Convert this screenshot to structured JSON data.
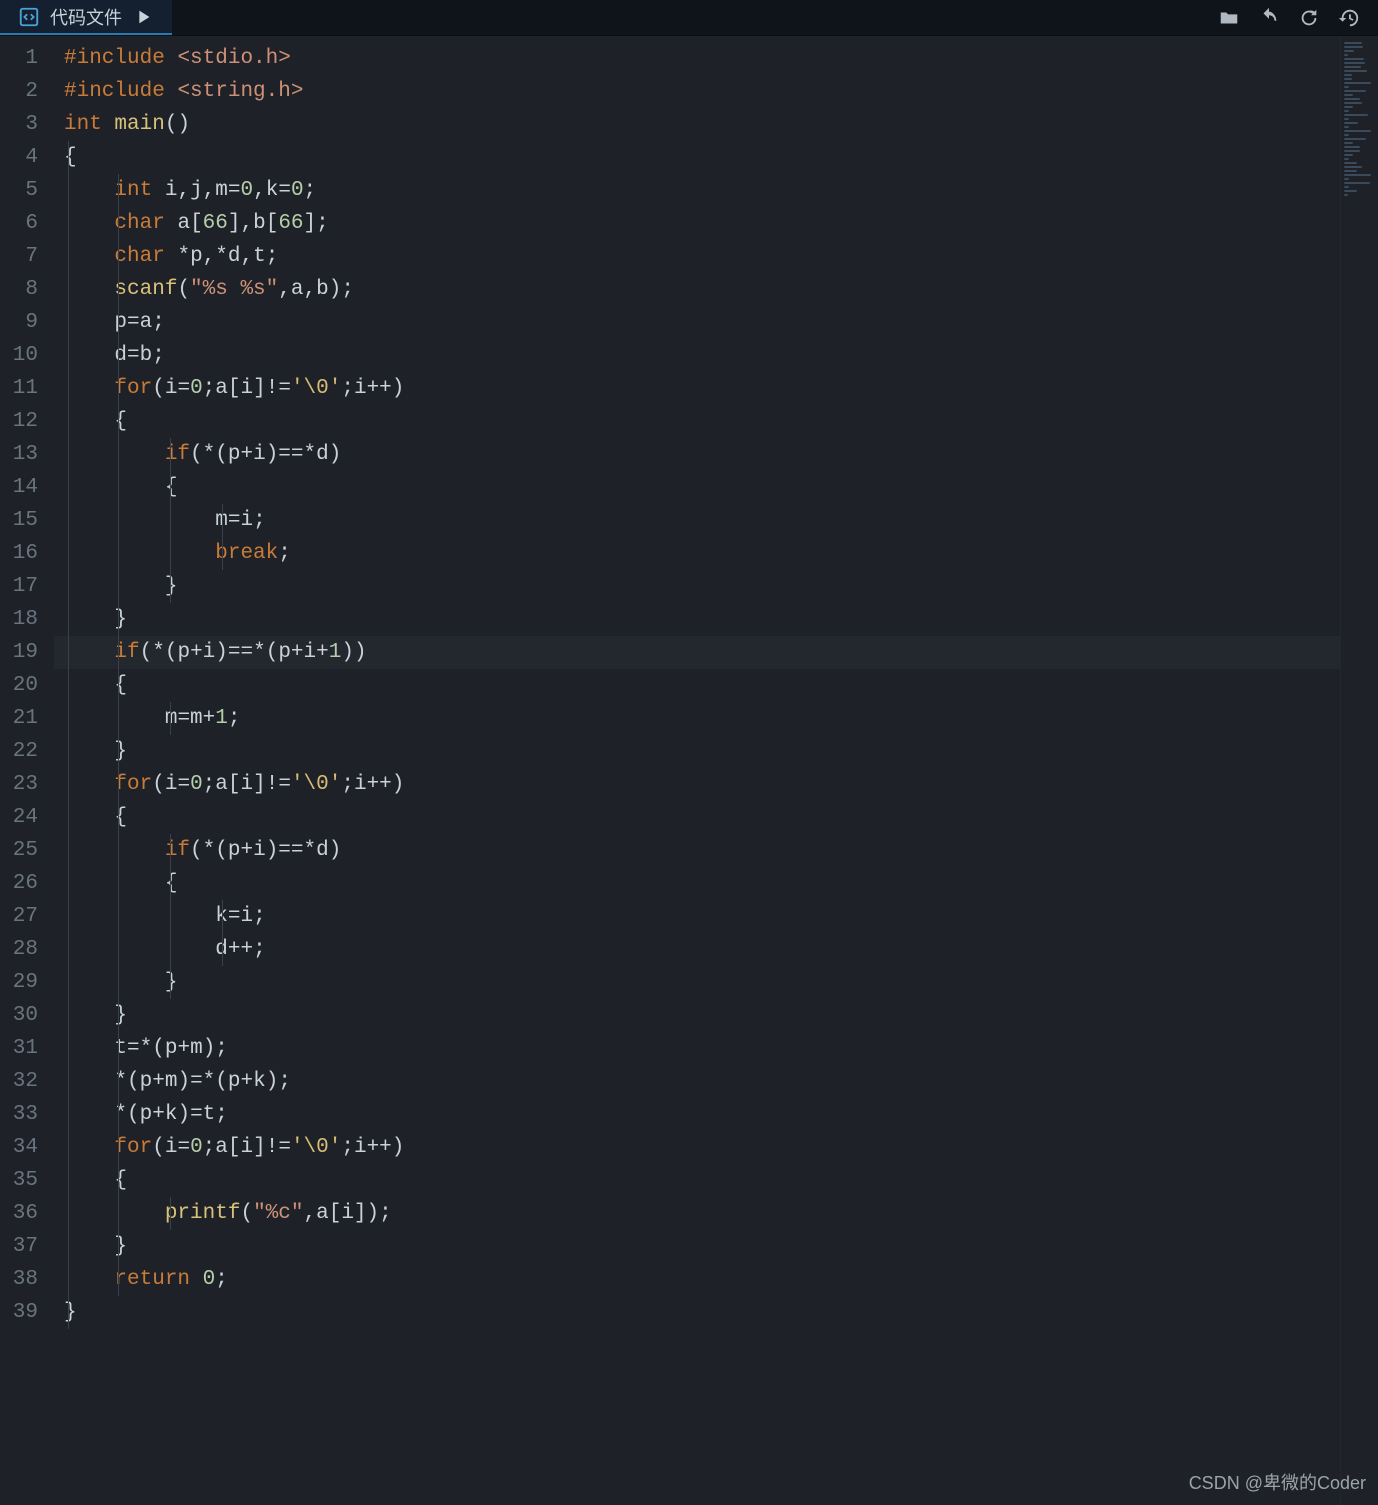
{
  "tab": {
    "label": "代码文件",
    "icon": "code-file-icon",
    "play_icon": "play-icon"
  },
  "toolbar": {
    "icons": [
      "folder-icon",
      "undo-icon",
      "refresh-icon",
      "history-icon"
    ]
  },
  "editor": {
    "highlighted_line": 19,
    "line_count": 39,
    "lines": [
      [
        [
          "inc",
          "#include"
        ],
        [
          "pn",
          " "
        ],
        [
          "hdr",
          "<stdio.h>"
        ]
      ],
      [
        [
          "inc",
          "#include"
        ],
        [
          "pn",
          " "
        ],
        [
          "hdr",
          "<string.h>"
        ]
      ],
      [
        [
          "ty",
          "int"
        ],
        [
          "pn",
          " "
        ],
        [
          "fn",
          "main"
        ],
        [
          "pn",
          "()"
        ]
      ],
      [
        [
          "pn",
          "{"
        ]
      ],
      [
        [
          "pn",
          "    "
        ],
        [
          "ty",
          "int"
        ],
        [
          "pn",
          " "
        ],
        [
          "id",
          "i"
        ],
        [
          "pn",
          ","
        ],
        [
          "id",
          "j"
        ],
        [
          "pn",
          ","
        ],
        [
          "id",
          "m"
        ],
        [
          "op",
          "="
        ],
        [
          "nu",
          "0"
        ],
        [
          "pn",
          ","
        ],
        [
          "id",
          "k"
        ],
        [
          "op",
          "="
        ],
        [
          "nu",
          "0"
        ],
        [
          "semi",
          ";"
        ]
      ],
      [
        [
          "pn",
          "    "
        ],
        [
          "ty",
          "char"
        ],
        [
          "pn",
          " "
        ],
        [
          "id",
          "a"
        ],
        [
          "pn",
          "["
        ],
        [
          "nu",
          "66"
        ],
        [
          "pn",
          "],"
        ],
        [
          "id",
          "b"
        ],
        [
          "pn",
          "["
        ],
        [
          "nu",
          "66"
        ],
        [
          "pn",
          "]"
        ],
        [
          "semi",
          ";"
        ]
      ],
      [
        [
          "pn",
          "    "
        ],
        [
          "ty",
          "char"
        ],
        [
          "pn",
          " *"
        ],
        [
          "id",
          "p"
        ],
        [
          "pn",
          ",*"
        ],
        [
          "id",
          "d"
        ],
        [
          "pn",
          ","
        ],
        [
          "id",
          "t"
        ],
        [
          "semi",
          ";"
        ]
      ],
      [
        [
          "pn",
          "    "
        ],
        [
          "fn",
          "scanf"
        ],
        [
          "pn",
          "("
        ],
        [
          "st",
          "\"%s %s\""
        ],
        [
          "pn",
          ","
        ],
        [
          "id",
          "a"
        ],
        [
          "pn",
          ","
        ],
        [
          "id",
          "b"
        ],
        [
          "pn",
          ")"
        ],
        [
          "semi",
          ";"
        ]
      ],
      [
        [
          "pn",
          "    "
        ],
        [
          "id",
          "p"
        ],
        [
          "op",
          "="
        ],
        [
          "id",
          "a"
        ],
        [
          "semi",
          ";"
        ]
      ],
      [
        [
          "pn",
          "    "
        ],
        [
          "id",
          "d"
        ],
        [
          "op",
          "="
        ],
        [
          "id",
          "b"
        ],
        [
          "semi",
          ";"
        ]
      ],
      [
        [
          "pn",
          "    "
        ],
        [
          "kw",
          "for"
        ],
        [
          "pn",
          "("
        ],
        [
          "id",
          "i"
        ],
        [
          "op",
          "="
        ],
        [
          "nu",
          "0"
        ],
        [
          "pn",
          ";"
        ],
        [
          "id",
          "a"
        ],
        [
          "pn",
          "["
        ],
        [
          "id",
          "i"
        ],
        [
          "pn",
          "]"
        ],
        [
          "op",
          "!="
        ],
        [
          "ch",
          "'\\0'"
        ],
        [
          "pn",
          ";"
        ],
        [
          "id",
          "i"
        ],
        [
          "op",
          "++"
        ],
        [
          "pn",
          ")"
        ]
      ],
      [
        [
          "pn",
          "    {"
        ]
      ],
      [
        [
          "pn",
          "        "
        ],
        [
          "kw",
          "if"
        ],
        [
          "pn",
          "(*("
        ],
        [
          "id",
          "p"
        ],
        [
          "op",
          "+"
        ],
        [
          "id",
          "i"
        ],
        [
          "pn",
          ")"
        ],
        [
          "op",
          "==*"
        ],
        [
          "id",
          "d"
        ],
        [
          "pn",
          ")"
        ]
      ],
      [
        [
          "pn",
          "        {"
        ]
      ],
      [
        [
          "pn",
          "            "
        ],
        [
          "id",
          "m"
        ],
        [
          "op",
          "="
        ],
        [
          "id",
          "i"
        ],
        [
          "semi",
          ";"
        ]
      ],
      [
        [
          "pn",
          "            "
        ],
        [
          "kw",
          "break"
        ],
        [
          "semi",
          ";"
        ]
      ],
      [
        [
          "pn",
          "        }"
        ]
      ],
      [
        [
          "pn",
          "    }"
        ]
      ],
      [
        [
          "pn",
          "    "
        ],
        [
          "kw",
          "if"
        ],
        [
          "pn",
          "(*("
        ],
        [
          "id",
          "p"
        ],
        [
          "op",
          "+"
        ],
        [
          "id",
          "i"
        ],
        [
          "pn",
          ")"
        ],
        [
          "op",
          "==*"
        ],
        [
          "pn",
          "("
        ],
        [
          "id",
          "p"
        ],
        [
          "op",
          "+"
        ],
        [
          "id",
          "i"
        ],
        [
          "op",
          "+"
        ],
        [
          "nu",
          "1"
        ],
        [
          "pn",
          "))"
        ]
      ],
      [
        [
          "pn",
          "    {"
        ]
      ],
      [
        [
          "pn",
          "        "
        ],
        [
          "id",
          "m"
        ],
        [
          "op",
          "="
        ],
        [
          "id",
          "m"
        ],
        [
          "op",
          "+"
        ],
        [
          "nu",
          "1"
        ],
        [
          "semi",
          ";"
        ]
      ],
      [
        [
          "pn",
          "    }"
        ]
      ],
      [
        [
          "pn",
          "    "
        ],
        [
          "kw",
          "for"
        ],
        [
          "pn",
          "("
        ],
        [
          "id",
          "i"
        ],
        [
          "op",
          "="
        ],
        [
          "nu",
          "0"
        ],
        [
          "pn",
          ";"
        ],
        [
          "id",
          "a"
        ],
        [
          "pn",
          "["
        ],
        [
          "id",
          "i"
        ],
        [
          "pn",
          "]"
        ],
        [
          "op",
          "!="
        ],
        [
          "ch",
          "'\\0'"
        ],
        [
          "pn",
          ";"
        ],
        [
          "id",
          "i"
        ],
        [
          "op",
          "++"
        ],
        [
          "pn",
          ")"
        ]
      ],
      [
        [
          "pn",
          "    {"
        ]
      ],
      [
        [
          "pn",
          "        "
        ],
        [
          "kw",
          "if"
        ],
        [
          "pn",
          "(*("
        ],
        [
          "id",
          "p"
        ],
        [
          "op",
          "+"
        ],
        [
          "id",
          "i"
        ],
        [
          "pn",
          ")"
        ],
        [
          "op",
          "==*"
        ],
        [
          "id",
          "d"
        ],
        [
          "pn",
          ")"
        ]
      ],
      [
        [
          "pn",
          "        {"
        ]
      ],
      [
        [
          "pn",
          "            "
        ],
        [
          "id",
          "k"
        ],
        [
          "op",
          "="
        ],
        [
          "id",
          "i"
        ],
        [
          "semi",
          ";"
        ]
      ],
      [
        [
          "pn",
          "            "
        ],
        [
          "id",
          "d"
        ],
        [
          "op",
          "++"
        ],
        [
          "semi",
          ";"
        ]
      ],
      [
        [
          "pn",
          "        }"
        ]
      ],
      [
        [
          "pn",
          "    }"
        ]
      ],
      [
        [
          "pn",
          "    "
        ],
        [
          "id",
          "t"
        ],
        [
          "op",
          "=*"
        ],
        [
          "pn",
          "("
        ],
        [
          "id",
          "p"
        ],
        [
          "op",
          "+"
        ],
        [
          "id",
          "m"
        ],
        [
          "pn",
          ")"
        ],
        [
          "semi",
          ";"
        ]
      ],
      [
        [
          "pn",
          "    *("
        ],
        [
          "id",
          "p"
        ],
        [
          "op",
          "+"
        ],
        [
          "id",
          "m"
        ],
        [
          "pn",
          ")"
        ],
        [
          "op",
          "=*"
        ],
        [
          "pn",
          "("
        ],
        [
          "id",
          "p"
        ],
        [
          "op",
          "+"
        ],
        [
          "id",
          "k"
        ],
        [
          "pn",
          ")"
        ],
        [
          "semi",
          ";"
        ]
      ],
      [
        [
          "pn",
          "    *("
        ],
        [
          "id",
          "p"
        ],
        [
          "op",
          "+"
        ],
        [
          "id",
          "k"
        ],
        [
          "pn",
          ")"
        ],
        [
          "op",
          "="
        ],
        [
          "id",
          "t"
        ],
        [
          "semi",
          ";"
        ]
      ],
      [
        [
          "pn",
          "    "
        ],
        [
          "kw",
          "for"
        ],
        [
          "pn",
          "("
        ],
        [
          "id",
          "i"
        ],
        [
          "op",
          "="
        ],
        [
          "nu",
          "0"
        ],
        [
          "pn",
          ";"
        ],
        [
          "id",
          "a"
        ],
        [
          "pn",
          "["
        ],
        [
          "id",
          "i"
        ],
        [
          "pn",
          "]"
        ],
        [
          "op",
          "!="
        ],
        [
          "ch",
          "'\\0'"
        ],
        [
          "pn",
          ";"
        ],
        [
          "id",
          "i"
        ],
        [
          "op",
          "++"
        ],
        [
          "pn",
          ")"
        ]
      ],
      [
        [
          "pn",
          "    {"
        ]
      ],
      [
        [
          "pn",
          "        "
        ],
        [
          "fn",
          "printf"
        ],
        [
          "pn",
          "("
        ],
        [
          "st",
          "\"%c\""
        ],
        [
          "pn",
          ","
        ],
        [
          "id",
          "a"
        ],
        [
          "pn",
          "["
        ],
        [
          "id",
          "i"
        ],
        [
          "pn",
          "])"
        ],
        [
          "semi",
          ";"
        ]
      ],
      [
        [
          "pn",
          "    }"
        ]
      ],
      [
        [
          "pn",
          "    "
        ],
        [
          "kw",
          "return"
        ],
        [
          "pn",
          " "
        ],
        [
          "nu",
          "0"
        ],
        [
          "semi",
          ";"
        ]
      ],
      [
        [
          "pn",
          "}"
        ]
      ]
    ]
  },
  "watermark": "CSDN @卑微的Coder"
}
